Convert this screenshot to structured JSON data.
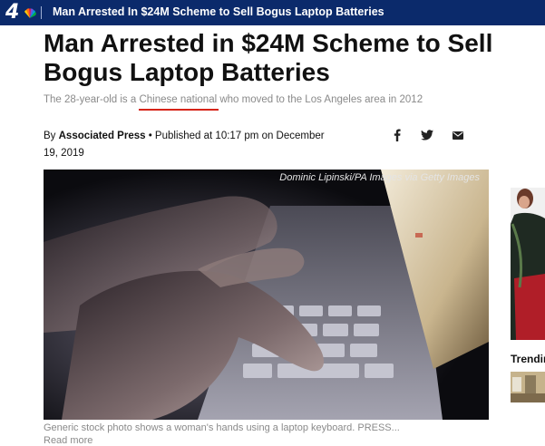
{
  "topbar": {
    "logo_number": "4",
    "title": "Man Arrested In $24M Scheme to Sell Bogus Laptop Batteries"
  },
  "article": {
    "headline": "Man Arrested in $24M Scheme to Sell Bogus Laptop Batteries",
    "subtitle_before": "The 28-year-old is a ",
    "subtitle_highlight": "Chinese national",
    "subtitle_after": " who moved to the Los Angeles area in 2012",
    "byline_prefix": "By ",
    "byline_author": "Associated Press",
    "byline_published_label": " • Published at 10:17 pm on December 19, 2019",
    "photo_credit": "Dominic Lipinski/PA Images via Getty Images",
    "caption": "Generic stock photo shows a woman's hands using a laptop keyboard. PRESS...",
    "caption_more": "Read more"
  },
  "share": {
    "icons": [
      "facebook-icon",
      "twitter-icon",
      "email-icon"
    ]
  },
  "sidebar": {
    "heading": "Trendin"
  },
  "colors": {
    "topbar": "#0b2a6b",
    "highlight_underline": "#d62418",
    "subtitle": "#8a8a8a"
  }
}
